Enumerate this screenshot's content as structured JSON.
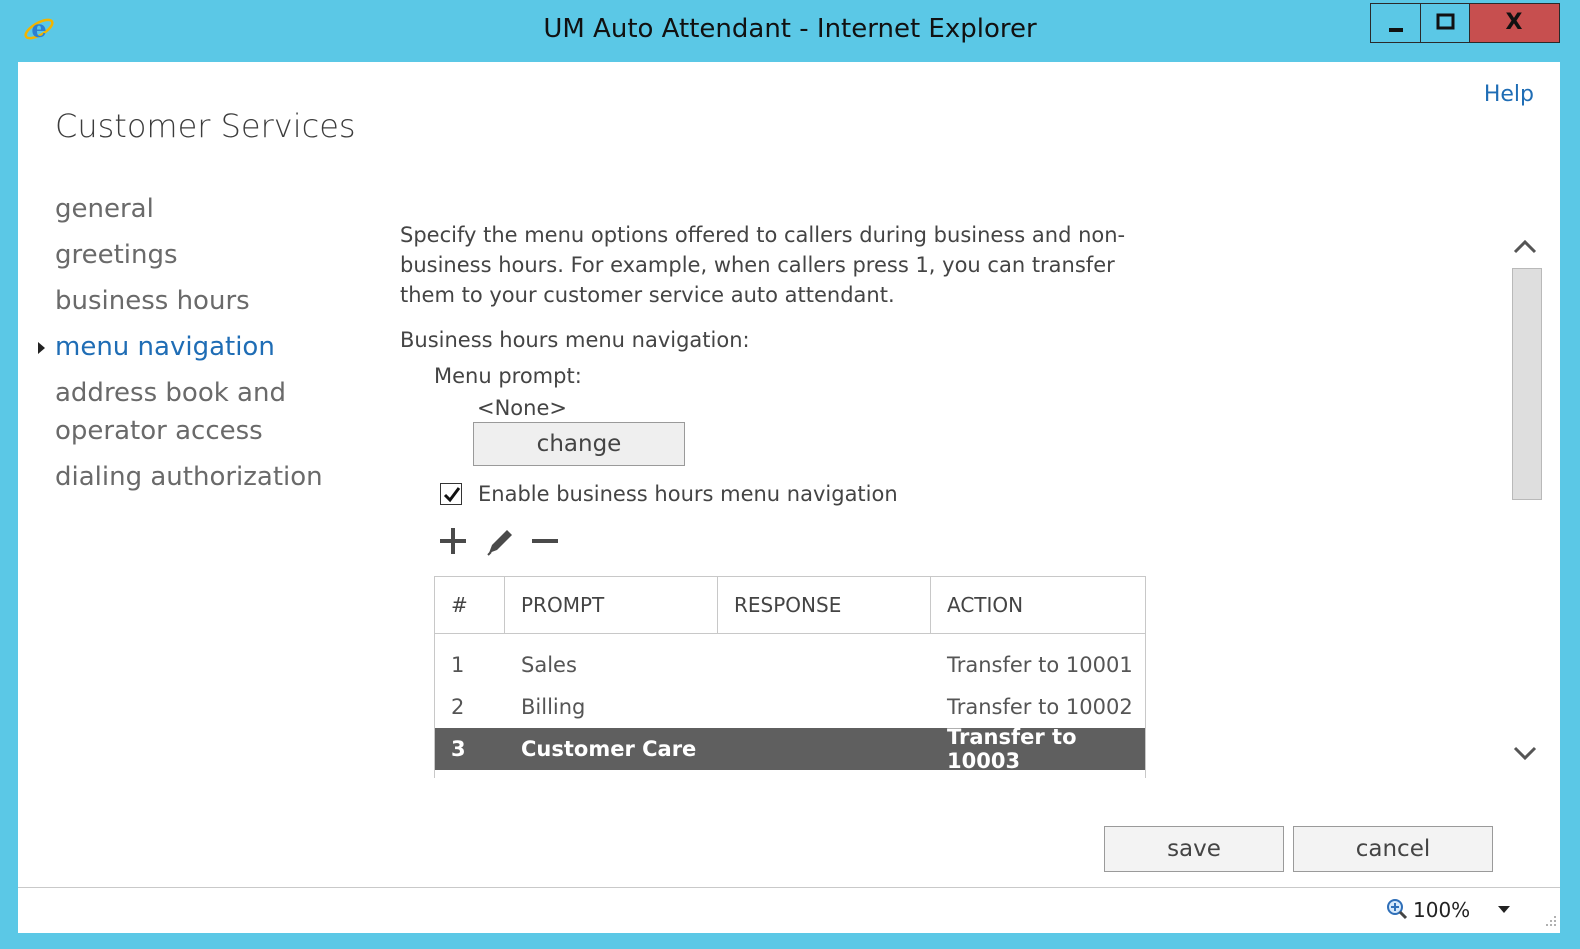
{
  "window": {
    "title": "UM Auto Attendant - Internet Explorer",
    "close_symbol": "X"
  },
  "header": {
    "help": "Help",
    "page_title": "Customer Services"
  },
  "nav": {
    "items": [
      {
        "label": "general"
      },
      {
        "label": "greetings"
      },
      {
        "label": "business hours"
      },
      {
        "label": "menu navigation",
        "active": true
      },
      {
        "label": "address book and operator access"
      },
      {
        "label": "dialing authorization"
      }
    ]
  },
  "main": {
    "description": "Specify the menu options offered to callers during business and non-business hours. For example, when callers press 1, you can transfer them to your customer service auto attendant.",
    "section_label": "Business hours menu navigation:",
    "menu_prompt_label": "Menu prompt:",
    "menu_prompt_value": "<None>",
    "change_button": "change",
    "enable_checkbox_label": "Enable business hours menu navigation",
    "enable_checked": true,
    "toolbar": {
      "add_icon": "plus-icon",
      "edit_icon": "pencil-icon",
      "remove_icon": "minus-icon"
    },
    "table": {
      "headers": [
        "#",
        "PROMPT",
        "RESPONSE",
        "ACTION"
      ],
      "rows": [
        {
          "num": "1",
          "prompt": "Sales",
          "response": "",
          "action": "Transfer to 10001"
        },
        {
          "num": "2",
          "prompt": "Billing",
          "response": "",
          "action": "Transfer to 10002"
        },
        {
          "num": "3",
          "prompt": "Customer Care",
          "response": "",
          "action": "Transfer to 10003",
          "selected": true
        }
      ]
    }
  },
  "footer": {
    "save": "save",
    "cancel": "cancel"
  },
  "status": {
    "zoom": "100%"
  },
  "colors": {
    "chrome": "#5bc8e6",
    "accent": "#1f6db5",
    "close": "#c74f4f",
    "selected_row": "#5f5f5f"
  }
}
